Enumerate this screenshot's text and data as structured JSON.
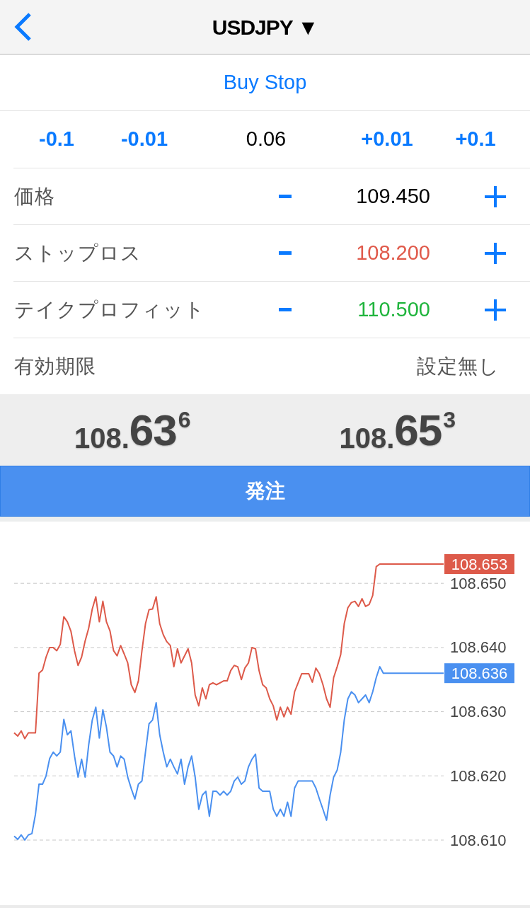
{
  "nav_bar": {
    "title": "USDJPY ▼"
  },
  "order_type": "Buy Stop",
  "volume": [
    {
      "kind": "step",
      "label": "-0.1"
    },
    {
      "kind": "step",
      "label": "-0.01"
    },
    {
      "kind": "value",
      "label": "0.06"
    },
    {
      "kind": "step",
      "label": "+0.01"
    },
    {
      "kind": "step",
      "label": "+0.1"
    }
  ],
  "fields": [
    {
      "label": "価格",
      "kind": "stepper",
      "value": "109.450",
      "color": "#000000"
    },
    {
      "label": "ストップロス",
      "kind": "stepper",
      "value": "108.200",
      "color": "#e05a4b"
    },
    {
      "label": "テイクプロフィット",
      "kind": "stepper",
      "value": "110.500",
      "color": "#1fb43c"
    },
    {
      "label": "有効期限",
      "kind": "select",
      "value": "設定無し",
      "color": "#555555"
    }
  ],
  "quotes": [
    {
      "head": "108.",
      "pips": "63",
      "fraction": "6"
    },
    {
      "head": "108.",
      "pips": "65",
      "fraction": "3"
    }
  ],
  "submit_button": "発注",
  "chart": {
    "chart_data": {
      "type": "line",
      "grid": true,
      "ylim": [
        108.61,
        108.653
      ],
      "yticks": [
        {
          "value": 108.653,
          "label": "108.653"
        },
        {
          "value": 108.65,
          "label": "108.650"
        },
        {
          "value": 108.64,
          "label": "108.640"
        },
        {
          "value": 108.636,
          "label": "108.636"
        },
        {
          "value": 108.63,
          "label": "108.630"
        },
        {
          "value": 108.62,
          "label": "108.620"
        },
        {
          "value": 108.61,
          "label": "108.610"
        }
      ],
      "series": [
        {
          "color": "#dd5a4a",
          "values": [
            108.6267,
            108.6262,
            108.627,
            108.6258,
            108.6267,
            108.6267,
            108.6267,
            108.636,
            108.6365,
            108.6385,
            108.64,
            108.64,
            108.6395,
            108.6405,
            108.6448,
            108.644,
            108.6425,
            108.6395,
            108.6372,
            108.6385,
            108.641,
            108.643,
            108.646,
            108.6479,
            108.644,
            108.6472,
            108.644,
            108.6426,
            108.6395,
            108.6387,
            108.6403,
            108.639,
            108.6376,
            108.6342,
            108.633,
            108.6348,
            108.6395,
            108.6437,
            108.6459,
            108.646,
            108.6479,
            108.6437,
            108.642,
            108.6409,
            108.6403,
            108.637,
            108.6398,
            108.6376,
            108.6387,
            108.6398,
            108.6376,
            108.6326,
            108.6309,
            108.6337,
            108.632,
            108.6342,
            108.6345,
            108.6342,
            108.6345,
            108.6348,
            108.6348,
            108.6364,
            108.6372,
            108.637,
            108.635,
            108.6368,
            108.6376,
            108.64,
            108.6398,
            108.6364,
            108.6342,
            108.6337,
            108.632,
            108.6309,
            108.6287,
            108.6307,
            108.6292,
            108.6307,
            108.6296,
            108.6331,
            108.6345,
            108.6359,
            108.6359,
            108.6359,
            108.6346,
            108.6368,
            108.6359,
            108.6342,
            108.632,
            108.6307,
            108.6353,
            108.637,
            108.6389,
            108.6437,
            108.6462,
            108.647,
            108.6472,
            108.6464,
            108.6476,
            108.6464,
            108.6467,
            108.6481,
            108.6526,
            108.653,
            108.653,
            108.653,
            108.653,
            108.653,
            108.653,
            108.653,
            108.653,
            108.653,
            108.653,
            108.653,
            108.653,
            108.653,
            108.653,
            108.653,
            108.653,
            108.653,
            108.653,
            108.653
          ]
        },
        {
          "color": "#4a90f0",
          "values": [
            108.6106,
            108.6101,
            108.6108,
            108.61,
            108.6108,
            108.611,
            108.614,
            108.6187,
            108.6187,
            108.62,
            108.6227,
            108.6237,
            108.6231,
            108.6237,
            108.6288,
            108.6264,
            108.627,
            108.6231,
            108.6198,
            108.6226,
            108.6198,
            108.6248,
            108.6287,
            108.6307,
            108.6259,
            108.6303,
            108.6276,
            108.6237,
            108.6231,
            108.6214,
            108.6231,
            108.6226,
            108.6198,
            108.618,
            108.6164,
            108.6187,
            108.6192,
            108.6237,
            108.6281,
            108.6287,
            108.6314,
            108.6264,
            108.6237,
            108.6214,
            108.6226,
            108.6214,
            108.6203,
            108.6226,
            108.6187,
            108.6214,
            108.6231,
            108.6198,
            108.6148,
            108.617,
            108.6176,
            108.6137,
            108.6176,
            108.6176,
            108.617,
            108.6176,
            108.617,
            108.6176,
            108.6192,
            108.6198,
            108.6187,
            108.6192,
            108.6214,
            108.6226,
            108.6234,
            108.6181,
            108.6176,
            108.6176,
            108.6176,
            108.6148,
            108.6137,
            108.6148,
            108.6137,
            108.6159,
            108.6137,
            108.6181,
            108.6192,
            108.6192,
            108.6192,
            108.6192,
            108.6192,
            108.6181,
            108.6164,
            108.6148,
            108.6131,
            108.617,
            108.6198,
            108.6209,
            108.6237,
            108.6287,
            108.632,
            108.6331,
            108.6326,
            108.6314,
            108.632,
            108.6326,
            108.6314,
            108.6331,
            108.6353,
            108.637,
            108.636,
            108.636,
            108.636,
            108.636,
            108.636,
            108.636,
            108.636,
            108.636,
            108.636,
            108.636,
            108.636,
            108.636,
            108.636,
            108.636,
            108.636,
            108.636,
            108.636,
            108.636
          ]
        }
      ]
    }
  }
}
